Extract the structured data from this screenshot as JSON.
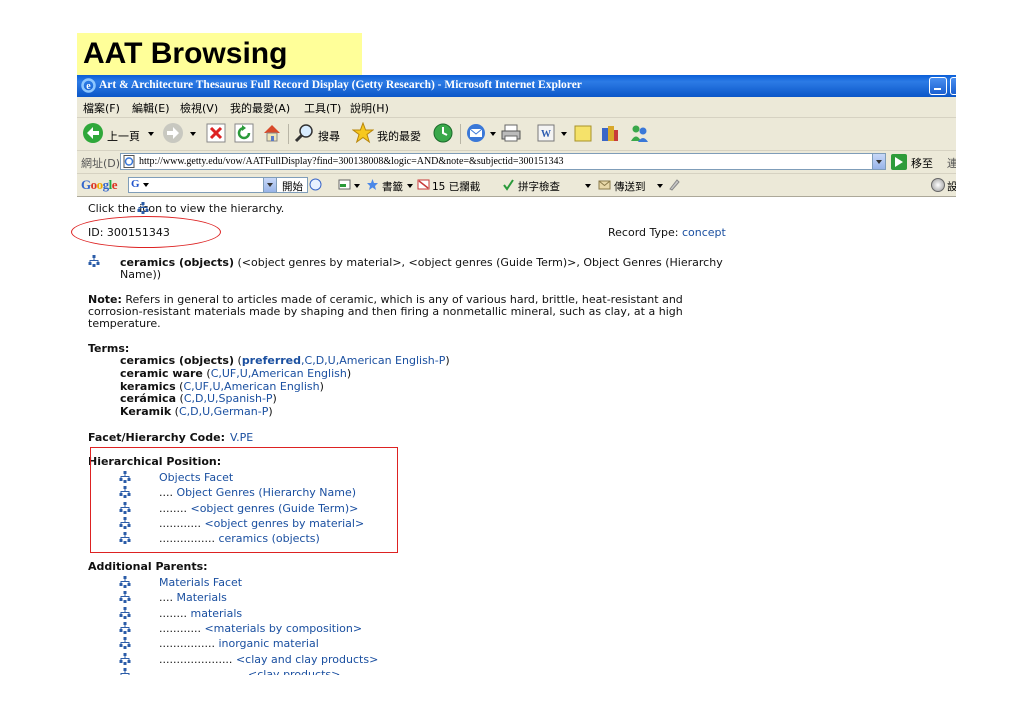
{
  "slide": {
    "title": "AAT Browsing"
  },
  "window": {
    "title": "Art & Architecture Thesaurus Full Record Display (Getty Research) - Microsoft Internet Explorer"
  },
  "menu": [
    "檔案(F)",
    "編輯(E)",
    "檢視(V)",
    "我的最愛(A)",
    "工具(T)",
    "說明(H)"
  ],
  "toolbar": {
    "back": "上一頁",
    "search": "搜尋",
    "favorites": "我的最愛"
  },
  "address": {
    "label": "網址(D)",
    "url": "http://www.getty.edu/vow/AATFullDisplay?find=300138008&logic=AND&note=&subjectid=300151343",
    "go": "移至",
    "links": "連"
  },
  "googlebar": {
    "logo": "Google",
    "g": "G",
    "start": "開始",
    "bookmarks": "書籤",
    "blocked": "15 已攔截",
    "spellcheck": "拼字檢查",
    "sendto": "傳送到",
    "settings": "設"
  },
  "record": {
    "instruction": "Click the   icon to view the hierarchy.",
    "id_label": "ID:",
    "id": "300151343",
    "record_type_label": "Record Type:",
    "record_type": "concept",
    "heading_term": "ceramics (objects)",
    "heading_rest": "(<object genres by material>, <object genres (Guide Term)>, Object Genres (Hierarchy",
    "heading_rest2": "Name))",
    "note_label": "Note:",
    "note_line1": "Refers in general to articles made of ceramic, which is any of various hard, brittle, heat-resistant and",
    "note_line2": "corrosion-resistant materials made by shaping and then firing a nonmetallic mineral, such as clay, at a high",
    "note_line3": "temperature.",
    "terms_label": "Terms:",
    "terms": [
      {
        "term": "ceramics (objects)",
        "open": " (",
        "flags": "preferred",
        "rest": ",C,D,U,American English-P",
        "close": ")",
        "term_bold": true,
        "flags_bold": true
      },
      {
        "term": "ceramic ware",
        "open": " (",
        "flags": "",
        "rest": "C,UF,U,American English",
        "close": ")",
        "term_bold": true,
        "flags_bold": false
      },
      {
        "term": "keramics",
        "open": " (",
        "flags": "",
        "rest": "C,UF,U,American English",
        "close": ")",
        "term_bold": true,
        "flags_bold": false
      },
      {
        "term": "cerámica",
        "open": " (",
        "flags": "",
        "rest": "C,D,U,Spanish-P",
        "close": ")",
        "term_bold": true,
        "flags_bold": false
      },
      {
        "term": "Keramik",
        "open": " (",
        "flags": "",
        "rest": "C,D,U,German-P",
        "close": ")",
        "term_bold": true,
        "flags_bold": false
      }
    ],
    "facet_label": "Facet/Hierarchy Code:",
    "facet_code": "V.PE",
    "hier_label": "Hierarchical Position:",
    "hierarchy": [
      {
        "prefix": "",
        "text": "Objects Facet"
      },
      {
        "prefix": ".... ",
        "text": "Object Genres (Hierarchy Name)"
      },
      {
        "prefix": "........ ",
        "text": "<object genres (Guide Term)>"
      },
      {
        "prefix": "............ ",
        "text": "<object genres by material>"
      },
      {
        "prefix": "................ ",
        "text": "ceramics (objects)"
      }
    ],
    "parents_label": "Additional Parents:",
    "parents": [
      {
        "prefix": "",
        "text": "Materials Facet"
      },
      {
        "prefix": ".... ",
        "text": "Materials"
      },
      {
        "prefix": "........ ",
        "text": "materials"
      },
      {
        "prefix": "............ ",
        "text": "<materials by composition>"
      },
      {
        "prefix": "................ ",
        "text": "inorganic material"
      },
      {
        "prefix": "..................... ",
        "text": "<clay and clay products>"
      },
      {
        "prefix": "",
        "text": "<clay products>"
      }
    ]
  },
  "colors": {
    "titlebar": "#0a5fd8",
    "link": "#1a4fa0",
    "annotation": "#dd2222",
    "slide_title_bg": "#ffff99"
  }
}
